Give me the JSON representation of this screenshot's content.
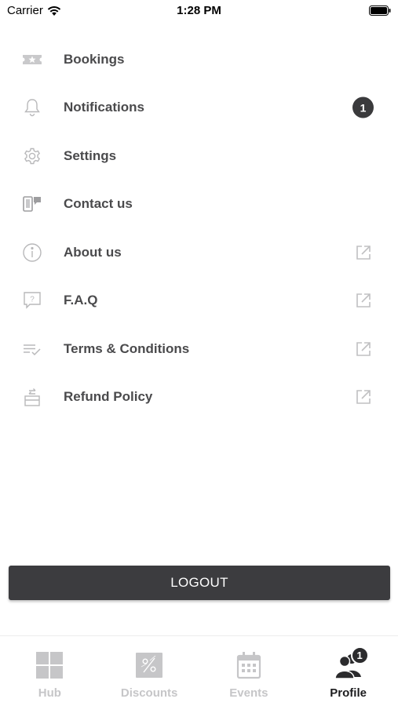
{
  "status_bar": {
    "carrier": "Carrier",
    "time": "1:28 PM"
  },
  "menu": {
    "items": [
      {
        "label": "Bookings",
        "icon": "ticket-star-icon"
      },
      {
        "label": "Notifications",
        "icon": "bell-icon",
        "badge": "1"
      },
      {
        "label": "Settings",
        "icon": "gear-icon"
      },
      {
        "label": "Contact us",
        "icon": "devices-icon"
      },
      {
        "label": "About us",
        "icon": "info-circle-icon",
        "external": true
      },
      {
        "label": "F.A.Q",
        "icon": "question-bubble-icon",
        "external": true
      },
      {
        "label": "Terms & Conditions",
        "icon": "list-check-icon",
        "external": true
      },
      {
        "label": "Refund Policy",
        "icon": "refund-icon",
        "external": true
      }
    ]
  },
  "logout_label": "LOGOUT",
  "tabs": [
    {
      "label": "Hub",
      "icon": "grid-icon"
    },
    {
      "label": "Discounts",
      "icon": "discount-icon"
    },
    {
      "label": "Events",
      "icon": "calendar-icon"
    },
    {
      "label": "Profile",
      "icon": "people-icon",
      "badge": "1",
      "active": true
    }
  ],
  "colors": {
    "accent_dark": "#3c3c3f",
    "text": "#4a4a4c",
    "inactive": "#c6c6c8"
  }
}
